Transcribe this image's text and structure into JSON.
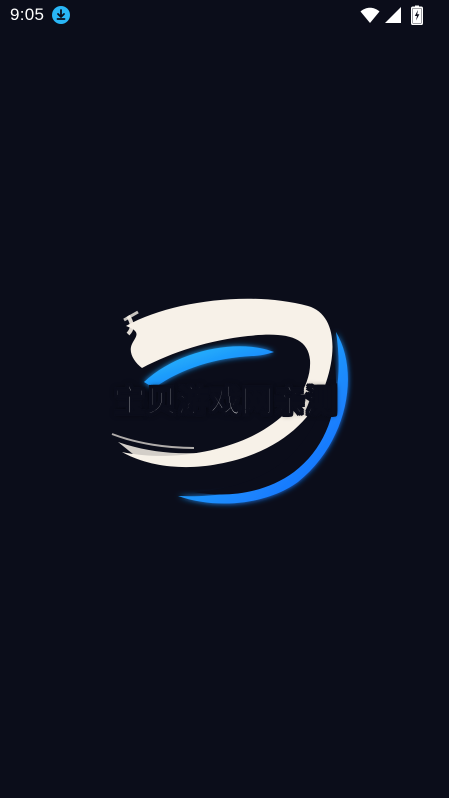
{
  "status_bar": {
    "time": "9:05",
    "icons": [
      "download-icon",
      "wifi-icon",
      "signal-icon",
      "battery-charging-icon"
    ]
  },
  "splash": {
    "logo_icon": "brush-stroke-swirl-logo",
    "title": "宝贝游戏网亲测"
  },
  "colors": {
    "background": "#0b0d1a",
    "brush_white": "#f7f1e8",
    "accent_blue": "#1e90ff",
    "accent_cyan": "#26c6f9",
    "download_badge": "#29b6f6"
  }
}
